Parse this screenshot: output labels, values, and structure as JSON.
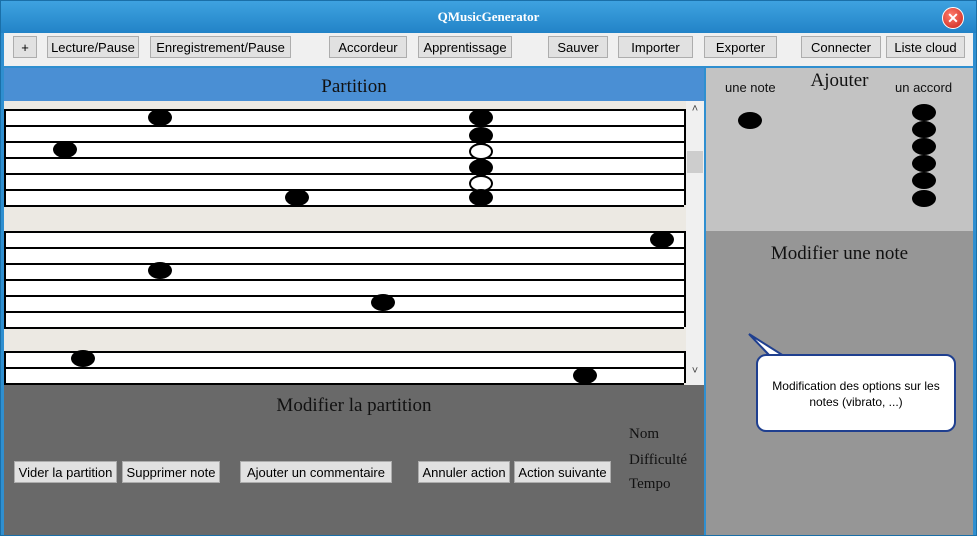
{
  "window": {
    "title": "QMusicGenerator"
  },
  "toolbar": {
    "add": "+",
    "play_pause": "Lecture/Pause",
    "record_pause": "Enregistrement/Pause",
    "tuner": "Accordeur",
    "learning": "Apprentissage",
    "save": "Sauver",
    "import": "Importer",
    "export": "Exporter",
    "connect": "Connecter",
    "cloud_list": "Liste cloud"
  },
  "partition": {
    "title": "Partition"
  },
  "edit_partition": {
    "title": "Modifier la partition",
    "clear": "Vider la partition",
    "delete_note": "Supprimer note",
    "add_comment": "Ajouter un commentaire",
    "undo": "Annuler action",
    "redo": "Action suivante",
    "name_label": "Nom",
    "difficulty_label": "Difficulté",
    "tempo_label": "Tempo"
  },
  "add_panel": {
    "title": "Ajouter",
    "single_note": "une note",
    "chord": "un accord"
  },
  "modify_note": {
    "title": "Modifier une note",
    "tooltip": "Modification des options sur les notes (vibrato, ...)"
  },
  "colors": {
    "title_bar": "#2283c7",
    "partition_header": "#4a8fd4",
    "edit_panel": "#696969",
    "add_panel": "#c3c3c3",
    "modify_panel": "#969696",
    "tooltip_border": "#1f3f8f"
  },
  "icons": {
    "close": "close-icon",
    "scroll_up": "chevron-up-icon",
    "scroll_down": "chevron-down-icon"
  }
}
